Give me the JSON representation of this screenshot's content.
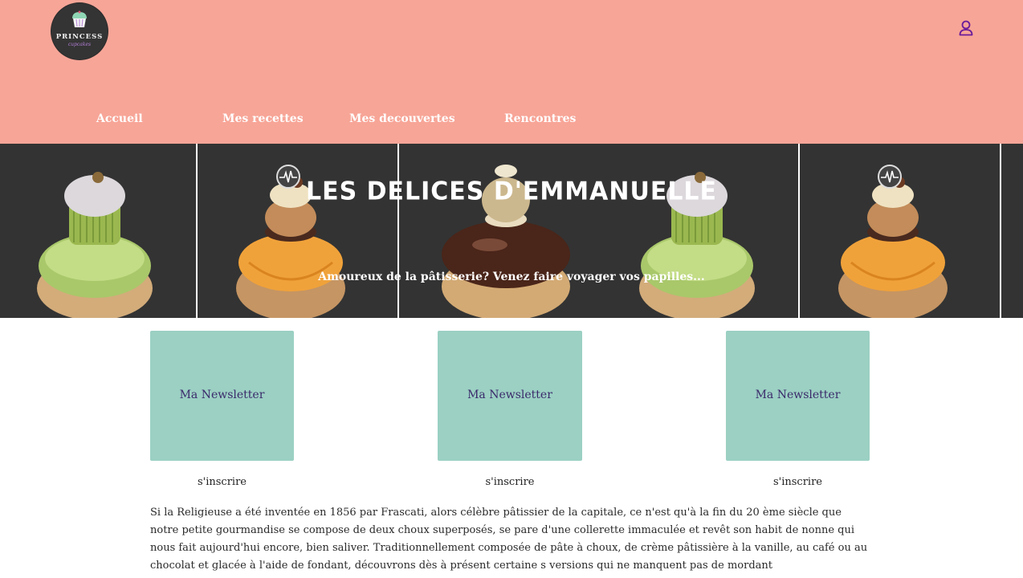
{
  "brand": {
    "logo_name": "PRINCESS",
    "logo_sub": "cupcakes"
  },
  "nav": {
    "items": [
      {
        "label": "Accueil"
      },
      {
        "label": "Mes recettes"
      },
      {
        "label": "Mes decouvertes"
      },
      {
        "label": "Rencontres"
      }
    ]
  },
  "hero": {
    "title": "LES DELICES D'EMMANUELLE",
    "subtitle": "Amoureux de la pâtisserie? Venez faire voyager vos papilles..."
  },
  "cards": [
    {
      "label": "Ma Newsletter",
      "action": "s'inscrire"
    },
    {
      "label": "Ma Newsletter",
      "action": "s'inscrire"
    },
    {
      "label": "Ma Newsletter",
      "action": "s'inscrire"
    }
  ],
  "article": {
    "text": "Si la Religieuse a été inventée en 1856 par Frascati, alors célèbre pâtissier de la capitale, ce n'est qu'à la fin du 20 ème siècle que notre petite gourmandise se compose de deux choux superposés, se pare d'une collerette immaculée et revêt son habit de nonne qui nous fait aujourd'hui encore, bien saliver. Traditionnellement composée de pâte à choux, de crème pâtissière à la vanille, au café ou au chocolat et glacée à l'aide de fondant, découvrons dès à présent certaine s versions qui ne manquent pas de mordant"
  },
  "icons": {
    "account": "user-icon",
    "badge": "heartbeat-icon"
  },
  "colors": {
    "header_bg": "#f7a597",
    "hero_bg": "#333333",
    "card_bg": "#9bd0c3",
    "card_text": "#3b2a6b",
    "account_icon": "#6a1b9a"
  }
}
